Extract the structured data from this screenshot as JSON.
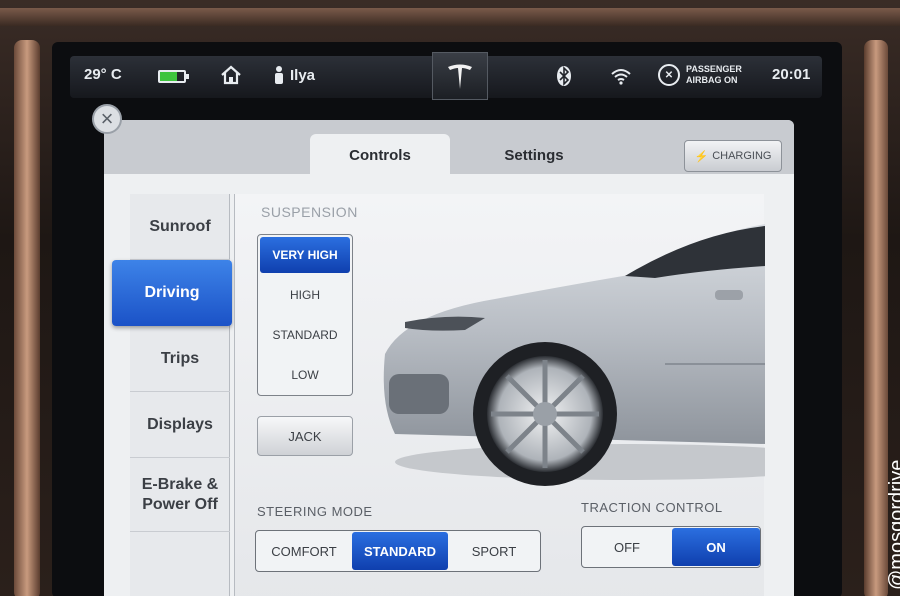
{
  "status": {
    "temperature": "29° C",
    "battery_level": 0.7,
    "user": "Ilya",
    "airbag_line1": "PASSENGER",
    "airbag_line2": "AIRBAG ON",
    "time": "20:01",
    "logo": "T"
  },
  "tabs": [
    {
      "label": "Controls",
      "active": true
    },
    {
      "label": "Settings",
      "active": false
    }
  ],
  "charging_label": "CHARGING",
  "sidebar": {
    "items": [
      {
        "label": "Sunroof"
      },
      {
        "label": "Driving"
      },
      {
        "label": "Trips"
      },
      {
        "label": "Displays"
      },
      {
        "label": "E-Brake &\nPower Off"
      }
    ],
    "active_index": 1
  },
  "suspension": {
    "label": "SUSPENSION",
    "options": [
      "VERY HIGH",
      "HIGH",
      "STANDARD",
      "LOW"
    ],
    "selected": "VERY HIGH"
  },
  "jack_label": "JACK",
  "steering": {
    "label": "STEERING MODE",
    "options": [
      "COMFORT",
      "STANDARD",
      "SPORT"
    ],
    "selected": "STANDARD"
  },
  "traction": {
    "label": "TRACTION CONTROL",
    "options": [
      "OFF",
      "ON"
    ],
    "selected": "ON"
  },
  "watermark": "@mosgordrive",
  "colors": {
    "accent_blue": "#1b52c7",
    "battery_green": "#3ec43e"
  },
  "icons": [
    "home-icon",
    "user-icon",
    "bluetooth-icon",
    "wifi-icon",
    "airbag-icon",
    "close-icon",
    "lightning-icon"
  ]
}
